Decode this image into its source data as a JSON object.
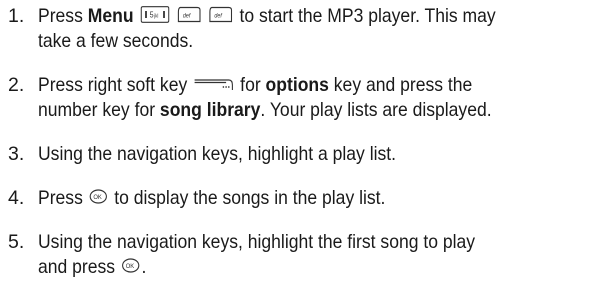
{
  "steps": [
    {
      "number": "1.",
      "line1_pre": "Press ",
      "bold1": "Menu",
      "line1_post": " to start the MP3 player. This may",
      "line2": "take a few seconds."
    },
    {
      "number": "2.",
      "line1_pre": "Press right soft key ",
      "line1_mid": " for ",
      "bold1": "options",
      "line1_post": " key and press the",
      "line2_pre": "number key for ",
      "bold2": "song library",
      "line2_post": ". Your play lists are displayed."
    },
    {
      "number": "3.",
      "line1": "Using the navigation keys, highlight a play list."
    },
    {
      "number": "4.",
      "line1_pre": "Press ",
      "line1_post": " to display the songs in the play list."
    },
    {
      "number": "5.",
      "line1": "Using the navigation keys, highlight the first song to play",
      "line2_pre": "and press ",
      "line2_post": "."
    }
  ],
  "icons": {
    "key_5": "key-5-jkl-icon",
    "key_3": "key-3-def-icon",
    "key_3b": "key-3-def-icon",
    "soft_key": "right-soft-key-icon",
    "ok": "ok-key-icon",
    "ok2": "ok-key-icon"
  },
  "key_labels": {
    "k5": "5",
    "k5_sub": "jkl",
    "k3a": "def",
    "k3b": "def",
    "ok": "OK",
    "ok2": "OK"
  }
}
